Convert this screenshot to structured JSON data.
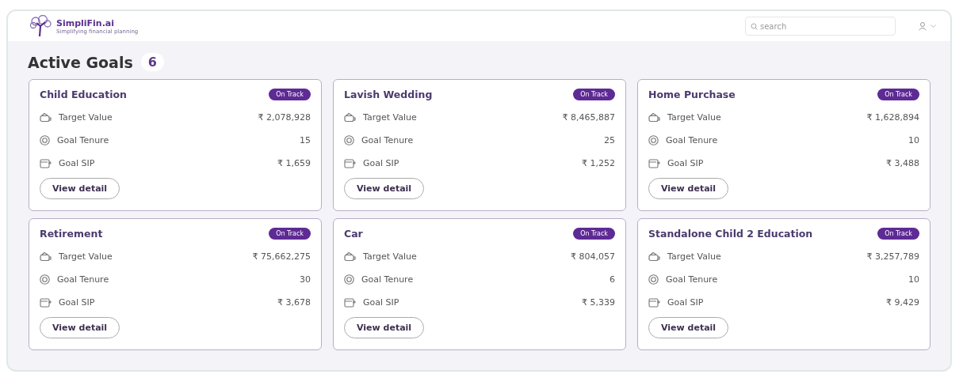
{
  "header": {
    "brand": "SimpliFin.ai",
    "tagline": "Simplifying financial planning",
    "search": {
      "placeholder": "search"
    }
  },
  "heading": {
    "title": "Active Goals",
    "count": "6"
  },
  "goals": [
    {
      "name": "Child Education",
      "status": "On Track",
      "rows": [
        {
          "kind": "target",
          "label": "Target Value",
          "value": "₹ 2,078,928"
        },
        {
          "kind": "tenure",
          "label": "Goal Tenure",
          "value": "15"
        },
        {
          "kind": "sip",
          "label": "Goal SIP",
          "value": "₹ 1,659"
        }
      ],
      "action": "View detail"
    },
    {
      "name": "Lavish Wedding",
      "status": "On Track",
      "rows": [
        {
          "kind": "target",
          "label": "Target Value",
          "value": "₹ 8,465,887"
        },
        {
          "kind": "tenure",
          "label": "Goal Tenure",
          "value": "25"
        },
        {
          "kind": "sip",
          "label": "Goal SIP",
          "value": "₹ 1,252"
        }
      ],
      "action": "View detail"
    },
    {
      "name": "Home Purchase",
      "status": "On Track",
      "rows": [
        {
          "kind": "target",
          "label": "Target Value",
          "value": "₹ 1,628,894"
        },
        {
          "kind": "tenure",
          "label": "Goal Tenure",
          "value": "10"
        },
        {
          "kind": "sip",
          "label": "Goal SIP",
          "value": "₹ 3,488"
        }
      ],
      "action": "View detail"
    },
    {
      "name": "Retirement",
      "status": "On Track",
      "rows": [
        {
          "kind": "target",
          "label": "Target Value",
          "value": "₹ 75,662,275"
        },
        {
          "kind": "tenure",
          "label": "Goal Tenure",
          "value": "30"
        },
        {
          "kind": "sip",
          "label": "Goal SIP",
          "value": "₹ 3,678"
        }
      ],
      "action": "View detail"
    },
    {
      "name": "Car",
      "status": "On Track",
      "rows": [
        {
          "kind": "target",
          "label": "Target Value",
          "value": "₹ 804,057"
        },
        {
          "kind": "tenure",
          "label": "Goal Tenure",
          "value": "6"
        },
        {
          "kind": "sip",
          "label": "Goal SIP",
          "value": "₹ 5,339"
        }
      ],
      "action": "View detail"
    },
    {
      "name": "Standalone Child 2 Education",
      "status": "On Track",
      "rows": [
        {
          "kind": "target",
          "label": "Target Value",
          "value": "₹ 3,257,789"
        },
        {
          "kind": "tenure",
          "label": "Goal Tenure",
          "value": "10"
        },
        {
          "kind": "sip",
          "label": "Goal SIP",
          "value": "₹ 9,429"
        }
      ],
      "action": "View detail"
    }
  ]
}
